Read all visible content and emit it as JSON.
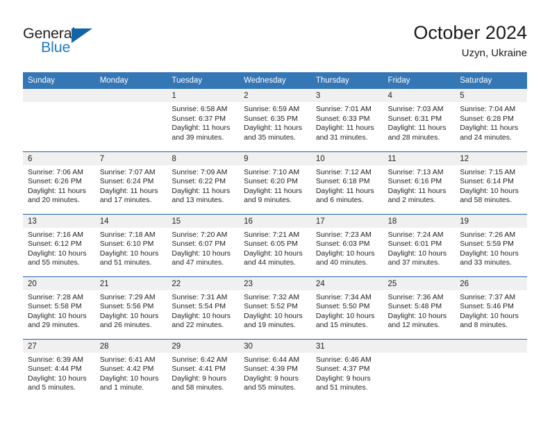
{
  "logo": {
    "name_part1": "General",
    "name_part2": "Blue",
    "icon": "triangle-icon",
    "color_dark": "#231f20",
    "color_blue": "#1f7bc1"
  },
  "header": {
    "title": "October 2024",
    "subtitle": "Uzyn, Ukraine"
  },
  "theme": {
    "header_bg": "#3576b5",
    "row_divider": "#1f63a8",
    "daynum_band": "#f0f0f0"
  },
  "weekdays": [
    "Sunday",
    "Monday",
    "Tuesday",
    "Wednesday",
    "Thursday",
    "Friday",
    "Saturday"
  ],
  "weeks": [
    [
      {
        "day": "",
        "empty": true
      },
      {
        "day": "",
        "empty": true
      },
      {
        "day": "1",
        "sunrise": "Sunrise: 6:58 AM",
        "sunset": "Sunset: 6:37 PM",
        "daylight": "Daylight: 11 hours and 39 minutes."
      },
      {
        "day": "2",
        "sunrise": "Sunrise: 6:59 AM",
        "sunset": "Sunset: 6:35 PM",
        "daylight": "Daylight: 11 hours and 35 minutes."
      },
      {
        "day": "3",
        "sunrise": "Sunrise: 7:01 AM",
        "sunset": "Sunset: 6:33 PM",
        "daylight": "Daylight: 11 hours and 31 minutes."
      },
      {
        "day": "4",
        "sunrise": "Sunrise: 7:03 AM",
        "sunset": "Sunset: 6:31 PM",
        "daylight": "Daylight: 11 hours and 28 minutes."
      },
      {
        "day": "5",
        "sunrise": "Sunrise: 7:04 AM",
        "sunset": "Sunset: 6:28 PM",
        "daylight": "Daylight: 11 hours and 24 minutes."
      }
    ],
    [
      {
        "day": "6",
        "sunrise": "Sunrise: 7:06 AM",
        "sunset": "Sunset: 6:26 PM",
        "daylight": "Daylight: 11 hours and 20 minutes."
      },
      {
        "day": "7",
        "sunrise": "Sunrise: 7:07 AM",
        "sunset": "Sunset: 6:24 PM",
        "daylight": "Daylight: 11 hours and 17 minutes."
      },
      {
        "day": "8",
        "sunrise": "Sunrise: 7:09 AM",
        "sunset": "Sunset: 6:22 PM",
        "daylight": "Daylight: 11 hours and 13 minutes."
      },
      {
        "day": "9",
        "sunrise": "Sunrise: 7:10 AM",
        "sunset": "Sunset: 6:20 PM",
        "daylight": "Daylight: 11 hours and 9 minutes."
      },
      {
        "day": "10",
        "sunrise": "Sunrise: 7:12 AM",
        "sunset": "Sunset: 6:18 PM",
        "daylight": "Daylight: 11 hours and 6 minutes."
      },
      {
        "day": "11",
        "sunrise": "Sunrise: 7:13 AM",
        "sunset": "Sunset: 6:16 PM",
        "daylight": "Daylight: 11 hours and 2 minutes."
      },
      {
        "day": "12",
        "sunrise": "Sunrise: 7:15 AM",
        "sunset": "Sunset: 6:14 PM",
        "daylight": "Daylight: 10 hours and 58 minutes."
      }
    ],
    [
      {
        "day": "13",
        "sunrise": "Sunrise: 7:16 AM",
        "sunset": "Sunset: 6:12 PM",
        "daylight": "Daylight: 10 hours and 55 minutes."
      },
      {
        "day": "14",
        "sunrise": "Sunrise: 7:18 AM",
        "sunset": "Sunset: 6:10 PM",
        "daylight": "Daylight: 10 hours and 51 minutes."
      },
      {
        "day": "15",
        "sunrise": "Sunrise: 7:20 AM",
        "sunset": "Sunset: 6:07 PM",
        "daylight": "Daylight: 10 hours and 47 minutes."
      },
      {
        "day": "16",
        "sunrise": "Sunrise: 7:21 AM",
        "sunset": "Sunset: 6:05 PM",
        "daylight": "Daylight: 10 hours and 44 minutes."
      },
      {
        "day": "17",
        "sunrise": "Sunrise: 7:23 AM",
        "sunset": "Sunset: 6:03 PM",
        "daylight": "Daylight: 10 hours and 40 minutes."
      },
      {
        "day": "18",
        "sunrise": "Sunrise: 7:24 AM",
        "sunset": "Sunset: 6:01 PM",
        "daylight": "Daylight: 10 hours and 37 minutes."
      },
      {
        "day": "19",
        "sunrise": "Sunrise: 7:26 AM",
        "sunset": "Sunset: 5:59 PM",
        "daylight": "Daylight: 10 hours and 33 minutes."
      }
    ],
    [
      {
        "day": "20",
        "sunrise": "Sunrise: 7:28 AM",
        "sunset": "Sunset: 5:58 PM",
        "daylight": "Daylight: 10 hours and 29 minutes."
      },
      {
        "day": "21",
        "sunrise": "Sunrise: 7:29 AM",
        "sunset": "Sunset: 5:56 PM",
        "daylight": "Daylight: 10 hours and 26 minutes."
      },
      {
        "day": "22",
        "sunrise": "Sunrise: 7:31 AM",
        "sunset": "Sunset: 5:54 PM",
        "daylight": "Daylight: 10 hours and 22 minutes."
      },
      {
        "day": "23",
        "sunrise": "Sunrise: 7:32 AM",
        "sunset": "Sunset: 5:52 PM",
        "daylight": "Daylight: 10 hours and 19 minutes."
      },
      {
        "day": "24",
        "sunrise": "Sunrise: 7:34 AM",
        "sunset": "Sunset: 5:50 PM",
        "daylight": "Daylight: 10 hours and 15 minutes."
      },
      {
        "day": "25",
        "sunrise": "Sunrise: 7:36 AM",
        "sunset": "Sunset: 5:48 PM",
        "daylight": "Daylight: 10 hours and 12 minutes."
      },
      {
        "day": "26",
        "sunrise": "Sunrise: 7:37 AM",
        "sunset": "Sunset: 5:46 PM",
        "daylight": "Daylight: 10 hours and 8 minutes."
      }
    ],
    [
      {
        "day": "27",
        "sunrise": "Sunrise: 6:39 AM",
        "sunset": "Sunset: 4:44 PM",
        "daylight": "Daylight: 10 hours and 5 minutes."
      },
      {
        "day": "28",
        "sunrise": "Sunrise: 6:41 AM",
        "sunset": "Sunset: 4:42 PM",
        "daylight": "Daylight: 10 hours and 1 minute."
      },
      {
        "day": "29",
        "sunrise": "Sunrise: 6:42 AM",
        "sunset": "Sunset: 4:41 PM",
        "daylight": "Daylight: 9 hours and 58 minutes."
      },
      {
        "day": "30",
        "sunrise": "Sunrise: 6:44 AM",
        "sunset": "Sunset: 4:39 PM",
        "daylight": "Daylight: 9 hours and 55 minutes."
      },
      {
        "day": "31",
        "sunrise": "Sunrise: 6:46 AM",
        "sunset": "Sunset: 4:37 PM",
        "daylight": "Daylight: 9 hours and 51 minutes."
      },
      {
        "day": "",
        "empty": true
      },
      {
        "day": "",
        "empty": true
      }
    ]
  ]
}
